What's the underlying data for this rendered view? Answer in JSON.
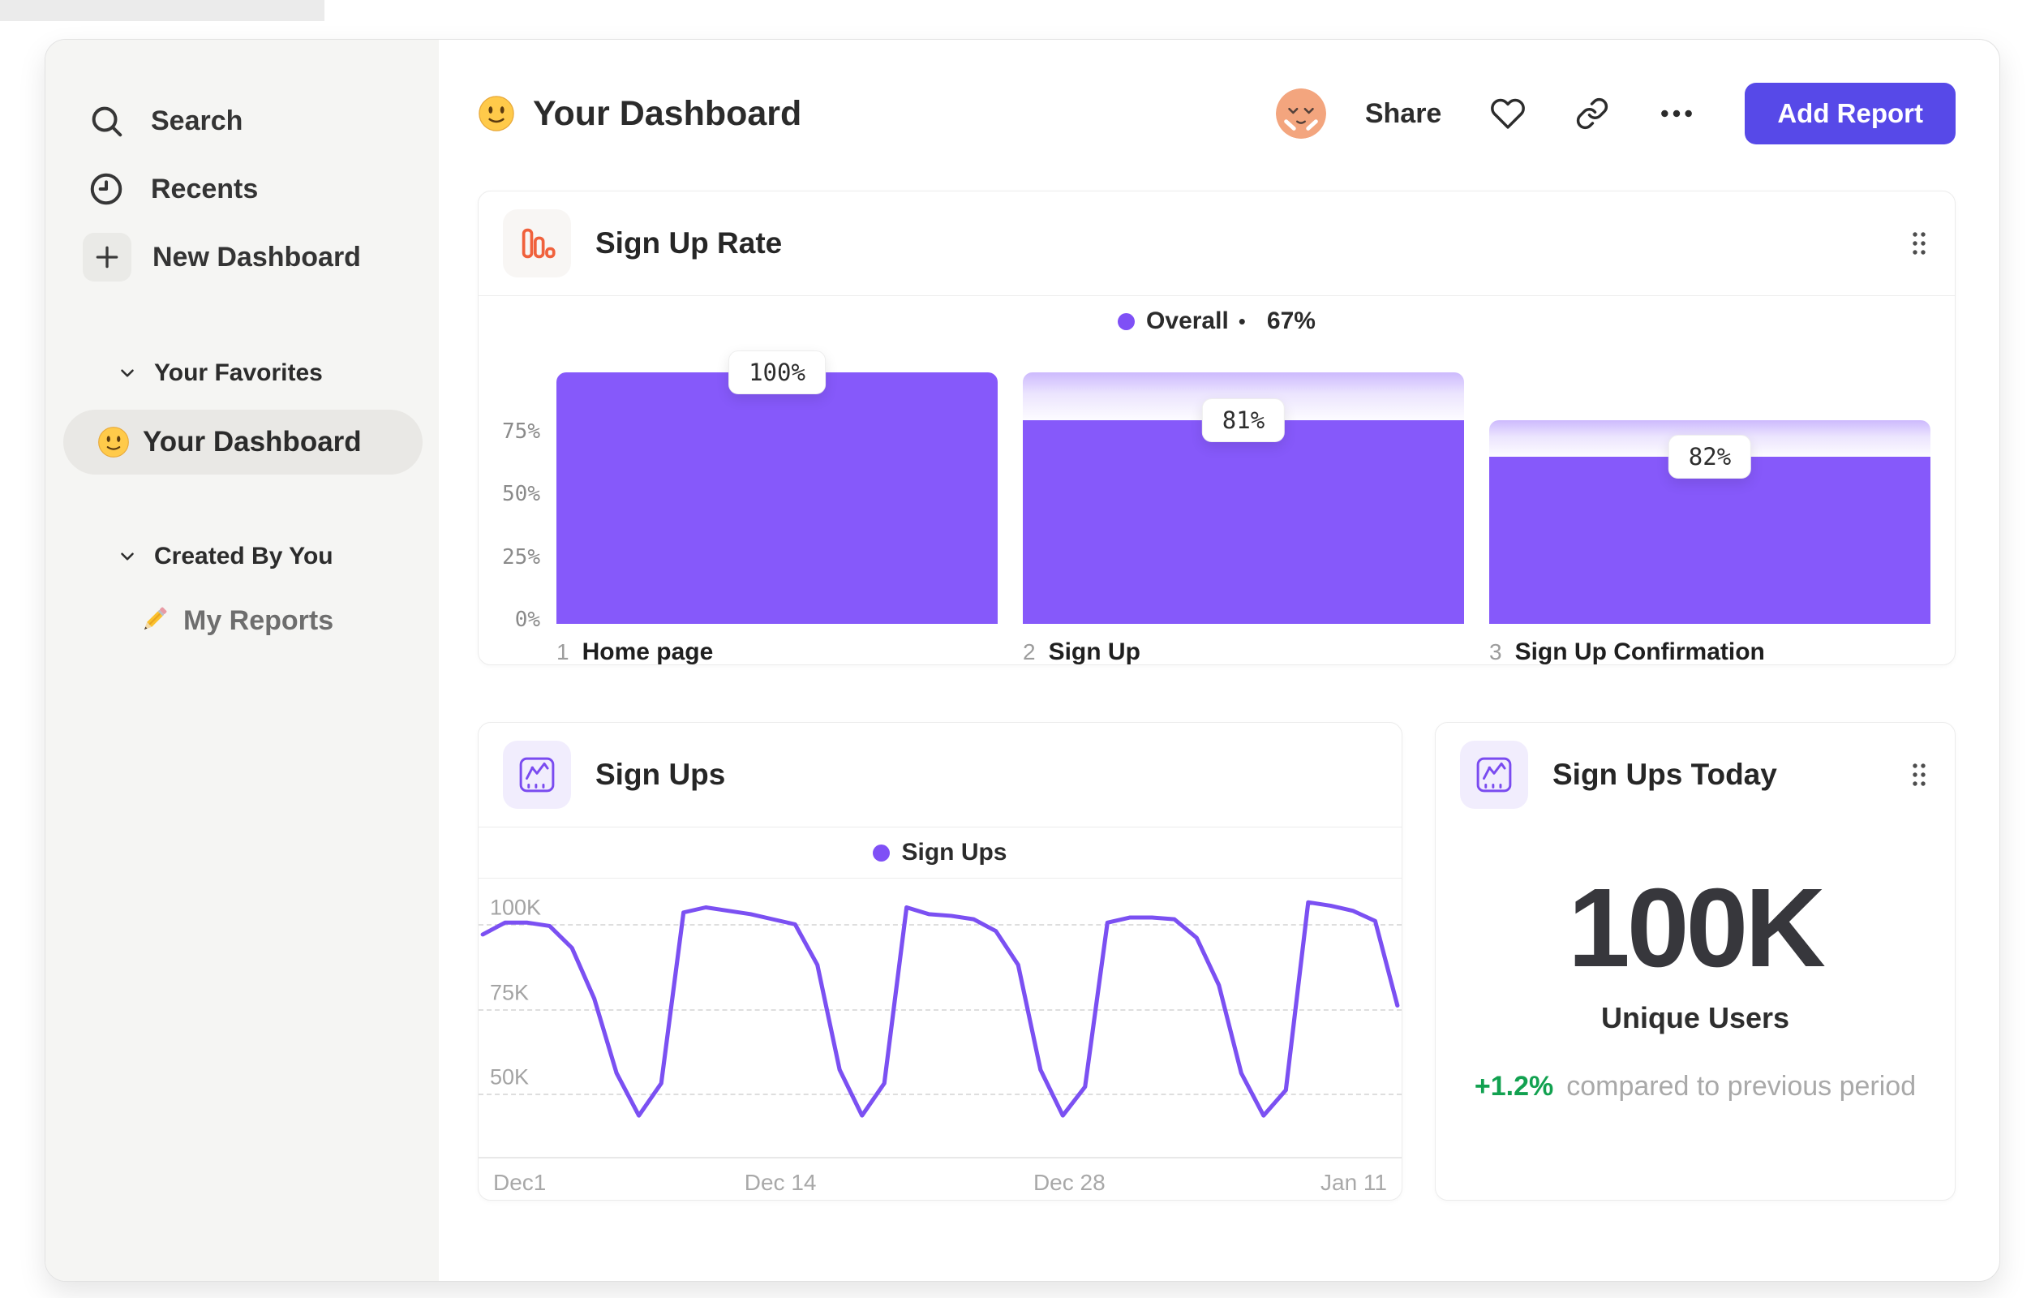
{
  "sidebar": {
    "search": "Search",
    "recents": "Recents",
    "new_dashboard": "New Dashboard",
    "favorites_header": "Your Favorites",
    "favorite_item": "Your Dashboard",
    "created_header": "Created By You",
    "created_item": "My Reports"
  },
  "header": {
    "title": "Your Dashboard",
    "share": "Share",
    "add_report": "Add Report"
  },
  "cards": {
    "rate": {
      "title": "Sign Up Rate"
    },
    "line": {
      "title": "Sign Ups"
    },
    "today": {
      "title": "Sign Ups Today",
      "value": "100K",
      "caption": "Unique Users",
      "delta": "+1.2%",
      "delta_caption": "compared to previous period"
    }
  },
  "colors": {
    "accent_purple": "#5749e8",
    "bar_purple": "#8659fa",
    "line_purple": "#7b50f2",
    "legend_dot": "#7f50f6",
    "orange": "#f0613c",
    "green": "#12a150"
  },
  "chart_data": [
    {
      "type": "bar",
      "subtype": "funnel",
      "title": "Sign Up Rate",
      "legend_label": "Overall",
      "legend_separator": "•",
      "overall": "67%",
      "step_numbers": [
        "1",
        "2",
        "3"
      ],
      "categories": [
        "Home page",
        "Sign Up",
        "Sign Up Confirmation"
      ],
      "values": [
        100,
        81,
        82
      ],
      "value_labels": [
        "100%",
        "81%",
        "82%"
      ],
      "y_ticks": [
        "75%",
        "50%",
        "25%",
        "0%"
      ],
      "y_tick_values": [
        75,
        50,
        25,
        0
      ],
      "ylim": [
        0,
        100
      ],
      "legend_position": "top-center",
      "grid": false
    },
    {
      "type": "line",
      "title": "Sign Ups",
      "series": [
        {
          "name": "Sign Ups",
          "values": [
            97,
            100.5,
            100.5,
            99.5,
            93,
            78,
            56,
            43.5,
            53,
            103.5,
            105,
            104,
            103,
            101.5,
            100,
            88,
            57,
            43.5,
            53,
            105,
            103,
            102.5,
            101.5,
            98,
            88,
            57,
            43.5,
            52,
            100.5,
            102,
            102,
            101.5,
            96,
            82,
            56,
            43.5,
            51,
            106.5,
            105.5,
            104,
            101,
            76
          ]
        }
      ],
      "unit": "K",
      "x_tick_labels": [
        "Dec1",
        "Dec 14",
        "Dec 28",
        "Jan 11"
      ],
      "y_ticks": [
        "100K",
        "75K",
        "50K"
      ],
      "y_tick_values": [
        100,
        75,
        50
      ],
      "ylim": [
        31,
        114
      ],
      "legend_position": "top-center",
      "grid": "dashed-horizontal"
    }
  ]
}
